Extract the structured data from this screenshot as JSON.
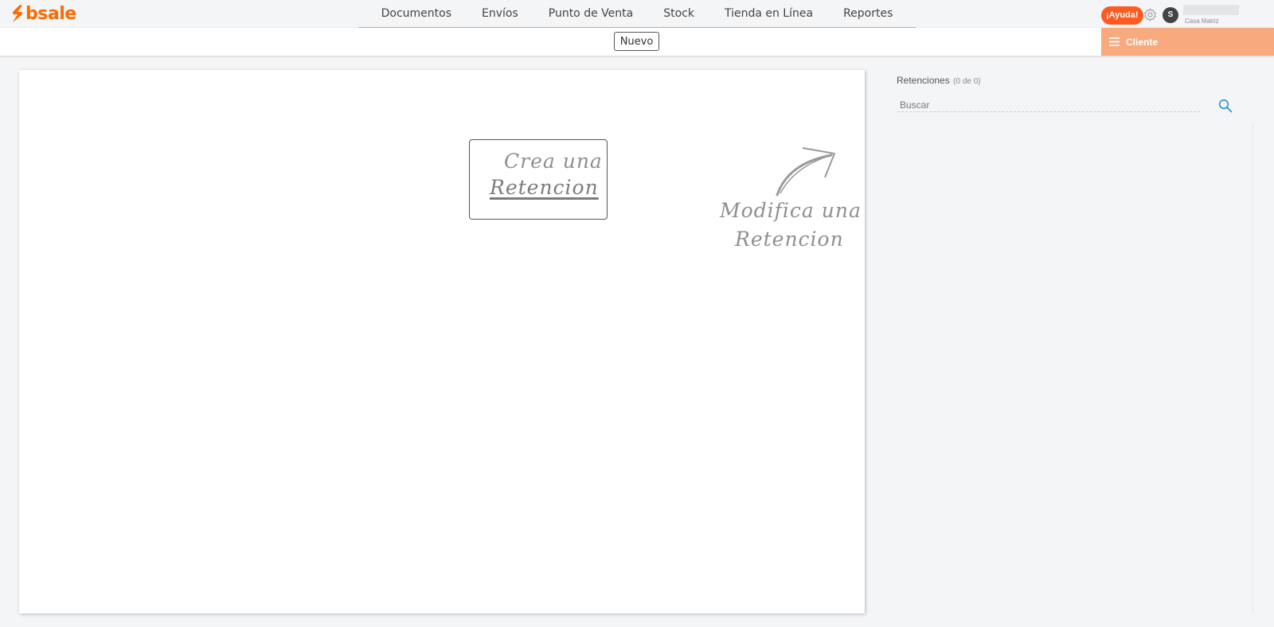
{
  "brand": {
    "name": "bsale",
    "color": "#ff6a00"
  },
  "nav": {
    "items": [
      "Documentos",
      "Envíos",
      "Punto de Venta",
      "Stock",
      "Tienda en Línea",
      "Reportes"
    ]
  },
  "header": {
    "help_label": "¡Ayuda!",
    "help_color": "#ff5a1f",
    "settings_icon": "gear-icon",
    "avatar_initial": "S",
    "branch_label": "Casa Matriz"
  },
  "toolbar": {
    "new_label": "Nuevo",
    "client_label": "Cliente",
    "client_icon": "hamburger-icon",
    "client_color": "#f9a97e"
  },
  "main": {
    "create_hint_line1": "Crea una",
    "create_hint_line2": "Retencion",
    "modify_hint_line1": "Modifica una",
    "modify_hint_line2": "Retencion"
  },
  "sidebar": {
    "title": "Retenciones",
    "count": "(0 de 0)",
    "search_placeholder": "Buscar",
    "search_icon": "search-icon"
  }
}
